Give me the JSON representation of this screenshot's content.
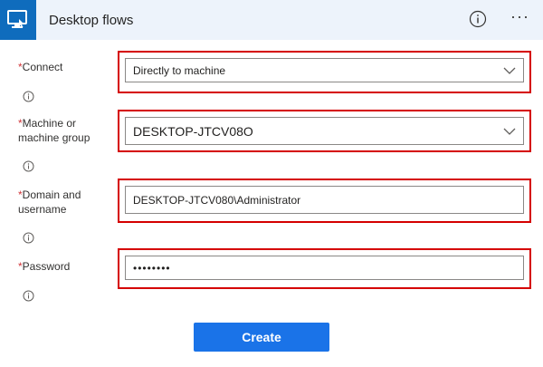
{
  "header": {
    "title": "Desktop flows",
    "more_label": "···"
  },
  "form": {
    "connect": {
      "required_mark": "*",
      "label": "Connect",
      "value": "Directly to machine"
    },
    "machine": {
      "required_mark": "*",
      "label": "Machine or machine group",
      "value": "DESKTOP-JTCV08O"
    },
    "domain": {
      "required_mark": "*",
      "label": "Domain and username",
      "value": "DESKTOP-JTCV080\\Administrator"
    },
    "password": {
      "required_mark": "*",
      "label": "Password",
      "value": "••••••••"
    }
  },
  "actions": {
    "create_label": "Create"
  },
  "colors": {
    "accent": "#0f6cbd",
    "button": "#1a73e8",
    "highlight": "#d50000",
    "required": "#d13438"
  }
}
